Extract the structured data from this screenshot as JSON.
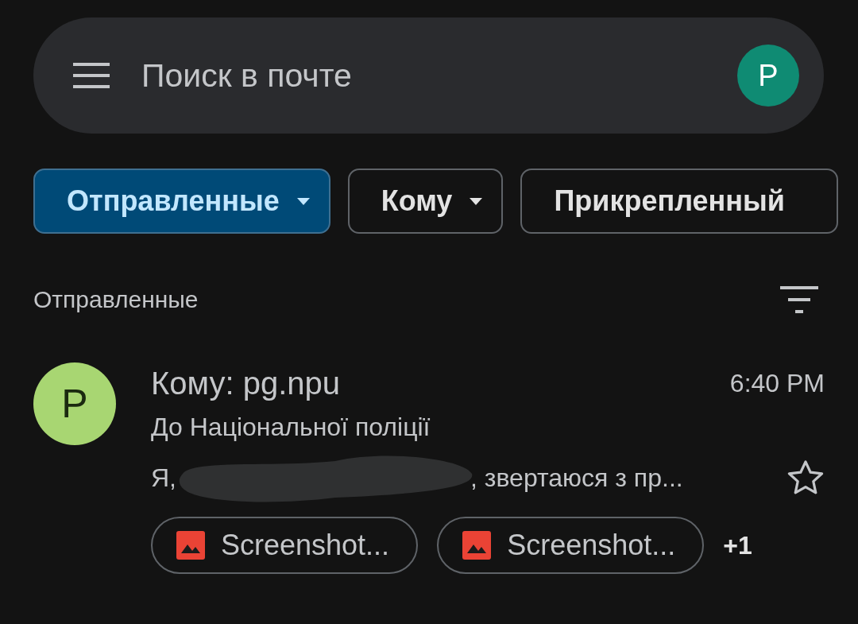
{
  "search": {
    "placeholder": "Поиск в почте",
    "avatar_letter": "P"
  },
  "filters": [
    {
      "label": "Отправленные",
      "selected": true,
      "dropdown": true
    },
    {
      "label": "Кому",
      "selected": false,
      "dropdown": true
    },
    {
      "label": "Прикрепленный",
      "selected": false,
      "dropdown": false
    }
  ],
  "section": {
    "title": "Отправленные"
  },
  "emails": [
    {
      "avatar_letter": "P",
      "sender": "Кому: pg.npu",
      "time": "6:40 PM",
      "subject": "До Національної поліції",
      "snippet_start": "Я,",
      "snippet_end": ", звертаюся з пр...",
      "redacted": true,
      "starred": false,
      "attachments": [
        "Screenshot...",
        "Screenshot..."
      ],
      "more_attachments": "+1"
    }
  ]
}
